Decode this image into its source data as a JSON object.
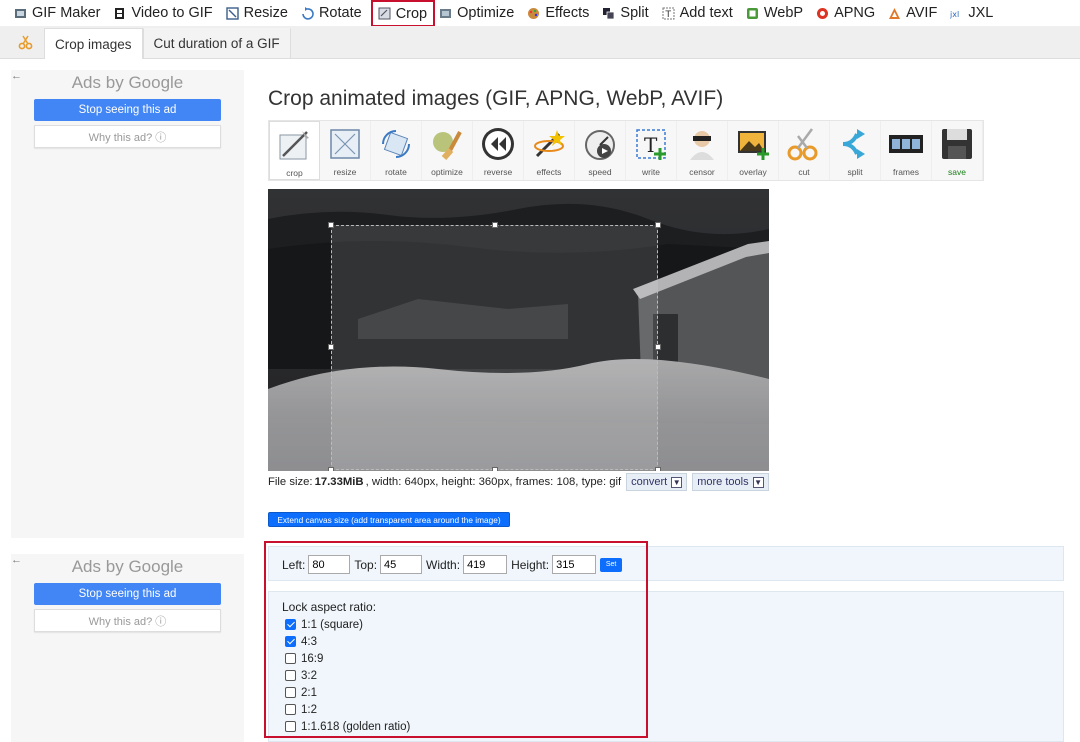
{
  "topnav": {
    "items": [
      {
        "label": "GIF Maker",
        "icon": "gif-maker-icon"
      },
      {
        "label": "Video to GIF",
        "icon": "film-icon"
      },
      {
        "label": "Resize",
        "icon": "resize-icon"
      },
      {
        "label": "Rotate",
        "icon": "rotate-icon"
      },
      {
        "label": "Crop",
        "icon": "crop-icon"
      },
      {
        "label": "Optimize",
        "icon": "optimize-icon"
      },
      {
        "label": "Effects",
        "icon": "palette-icon"
      },
      {
        "label": "Split",
        "icon": "split-icon"
      },
      {
        "label": "Add text",
        "icon": "text-icon"
      },
      {
        "label": "WebP",
        "icon": "webp-icon"
      },
      {
        "label": "APNG",
        "icon": "apng-icon"
      },
      {
        "label": "AVIF",
        "icon": "avif-icon"
      },
      {
        "label": "JXL",
        "icon": "jxl-icon"
      }
    ],
    "active": "Crop"
  },
  "subnav": {
    "tabs": [
      {
        "label": "Crop images"
      },
      {
        "label": "Cut duration of a GIF"
      }
    ]
  },
  "ads": [
    {
      "back": "←",
      "ads_by": "Ads by",
      "brand": "Google",
      "stop": "Stop seeing this ad",
      "why": "Why this ad? ⓘ"
    },
    {
      "back": "←",
      "ads_by": "Ads by",
      "brand": "Google",
      "stop": "Stop seeing this ad",
      "why": "Why this ad? ⓘ"
    }
  ],
  "main": {
    "title": "Crop animated images (GIF, APNG, WebP, AVIF)",
    "tools": [
      {
        "label": "crop",
        "icon": "crop-tool-icon"
      },
      {
        "label": "resize",
        "icon": "resize-tool-icon"
      },
      {
        "label": "rotate",
        "icon": "rotate-tool-icon"
      },
      {
        "label": "optimize",
        "icon": "optimize-tool-icon"
      },
      {
        "label": "reverse",
        "icon": "reverse-tool-icon"
      },
      {
        "label": "effects",
        "icon": "effects-tool-icon"
      },
      {
        "label": "speed",
        "icon": "speed-tool-icon"
      },
      {
        "label": "write",
        "icon": "write-tool-icon"
      },
      {
        "label": "censor",
        "icon": "censor-tool-icon"
      },
      {
        "label": "overlay",
        "icon": "overlay-tool-icon"
      },
      {
        "label": "cut",
        "icon": "cut-tool-icon"
      },
      {
        "label": "split",
        "icon": "split-tool-icon"
      },
      {
        "label": "frames",
        "icon": "frames-tool-icon"
      },
      {
        "label": "save",
        "icon": "save-tool-icon"
      }
    ],
    "file_info": {
      "prefix": "File size:",
      "size": "17.33MiB",
      "details": ", width: 640px, height: 360px, frames: 108, type: gif",
      "convert": "convert",
      "more_tools": "more tools"
    },
    "extend_button": "Extend canvas size (add transparent area around the image)",
    "coords": {
      "left_label": "Left:",
      "left": "80",
      "top_label": "Top:",
      "top": "45",
      "width_label": "Width:",
      "width": "419",
      "height_label": "Height:",
      "height": "315",
      "set": "Set"
    },
    "aspect": {
      "title": "Lock aspect ratio:",
      "options": [
        {
          "label": "1:1 (square)",
          "checked": true
        },
        {
          "label": "4:3",
          "checked": true
        },
        {
          "label": "16:9",
          "checked": false
        },
        {
          "label": "3:2",
          "checked": false
        },
        {
          "label": "2:1",
          "checked": false
        },
        {
          "label": "1:2",
          "checked": false
        },
        {
          "label": "1:1.618 (golden ratio)",
          "checked": false
        }
      ]
    }
  },
  "colors": {
    "highlight": "#c8102e",
    "primary_button": "#0d6efd",
    "google_blue": "#4285f4",
    "panel_bg": "#f0f6fb"
  }
}
